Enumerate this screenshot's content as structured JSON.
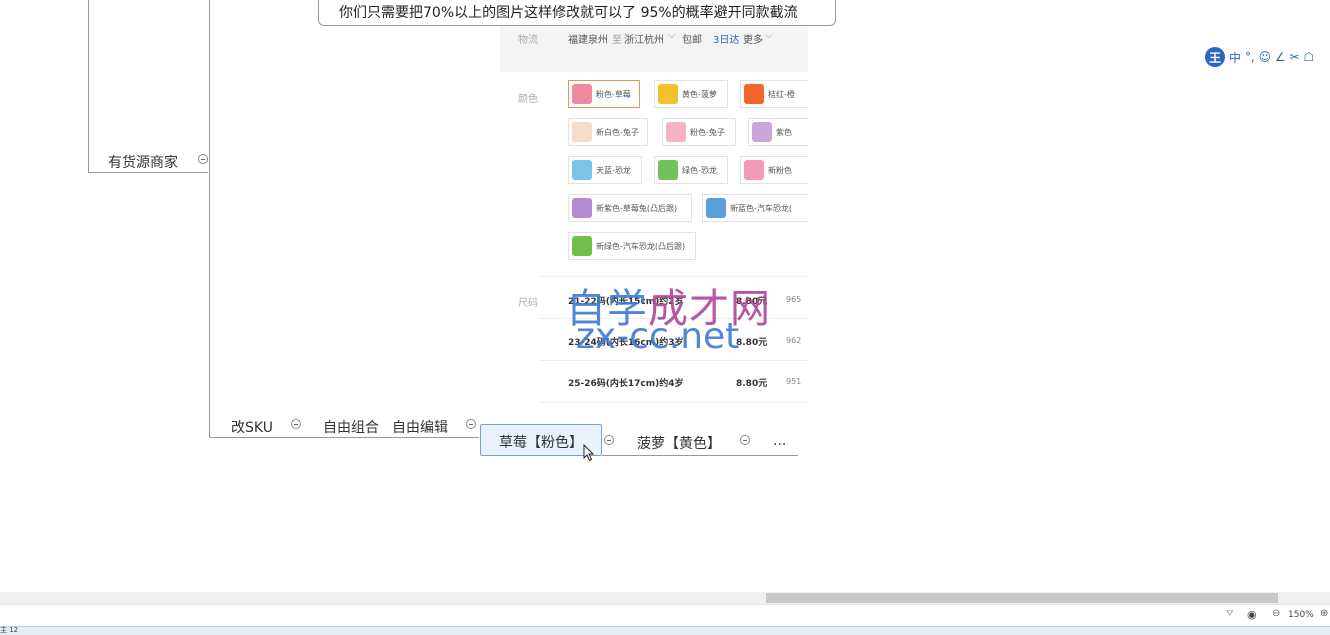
{
  "note": {
    "text": "你们只需要把70%以上的图片这样修改就可以了  95%的概率避开同款截流"
  },
  "nodes": {
    "supplier": "有货源商家",
    "change_sku": "改SKU",
    "free_combo": "自由组合",
    "free_edit": "自由编辑",
    "strawberry": "草莓【粉色】",
    "pineapple": "菠萝【黄色】",
    "more": "..."
  },
  "product": {
    "ship_label": "物流",
    "ship_from": "福建泉州",
    "ship_to_prefix": "至",
    "ship_to": "浙江杭州",
    "free_shipping": "包邮",
    "delivery": "3日达",
    "more": "更多",
    "color_label": "颜色",
    "size_label": "尺码",
    "colors": [
      {
        "label": "粉色-草莓",
        "color": "#f08aa0"
      },
      {
        "label": "黄色-菠萝",
        "color": "#f2c12e"
      },
      {
        "label": "桔红-橙",
        "color": "#f0662a"
      },
      {
        "label": "新白色-兔子",
        "color": "#f3dcc8"
      },
      {
        "label": "粉色-兔子",
        "color": "#f4b3c3"
      },
      {
        "label": "紫色",
        "color": "#c9a6dc"
      },
      {
        "label": "天蓝-恐龙",
        "color": "#7cc3e8"
      },
      {
        "label": "绿色-恐龙",
        "color": "#74c05a"
      },
      {
        "label": "新粉色",
        "color": "#f29ab8"
      },
      {
        "label": "新紫色-草莓兔(凸后跟)",
        "color": "#b48ad0"
      },
      {
        "label": "新蓝色-汽车恐龙(",
        "color": "#5a9fd8"
      },
      {
        "label": "新绿色-汽车恐龙(凸后跟)",
        "color": "#6fbf4a"
      }
    ],
    "sizes": [
      {
        "label": "21-22码(内长15cm)约2岁",
        "price": "8.80元",
        "stock": "965"
      },
      {
        "label": "23-24码(内长16cm)约3岁",
        "price": "8.80元",
        "stock": "962"
      },
      {
        "label": "25-26码(内长17cm)约4岁",
        "price": "8.80元",
        "stock": "951"
      }
    ]
  },
  "watermark": {
    "line1a": "自学",
    "line1b": "成才网",
    "line2": "zx-cc.net"
  },
  "ime": {
    "badge": "王",
    "lang": "中",
    "tools": "°, ☺ ∠ ✂ ☖"
  },
  "status": {
    "zoom": "150%",
    "left_text": "主 12"
  }
}
